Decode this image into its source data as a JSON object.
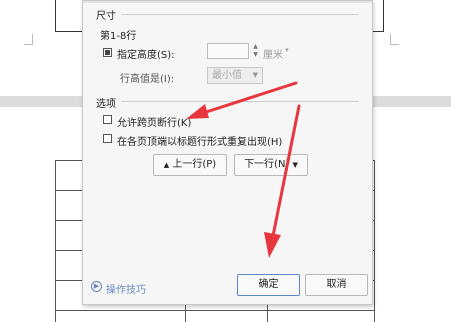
{
  "dialog": {
    "size_section": {
      "title": "尺寸",
      "rows_label": "第1-8行",
      "specify_height_label": "指定高度(S):",
      "height_value": "",
      "height_unit": "厘米",
      "row_height_is_label": "行高值是(I):",
      "row_height_mode": "最小值"
    },
    "options_section": {
      "title": "选项",
      "allow_row_break_label": "允许跨页断行(K)",
      "repeat_header_label": "在各页顶端以标题行形式重复出现(H)",
      "prev_row_button": "上一行(P)",
      "next_row_button": "下一行(N)"
    },
    "footer": {
      "tips_label": "操作技巧",
      "ok_button": "确定",
      "cancel_button": "取消"
    },
    "icons": {
      "tips": "play-circle-icon",
      "prev": "up-arrow-icon",
      "next": "down-arrow-icon",
      "spinner": "spinner-arrows-icon",
      "dropdown": "chevron-down-icon"
    }
  },
  "annotations": {
    "arrow_color": "#e8363f"
  }
}
